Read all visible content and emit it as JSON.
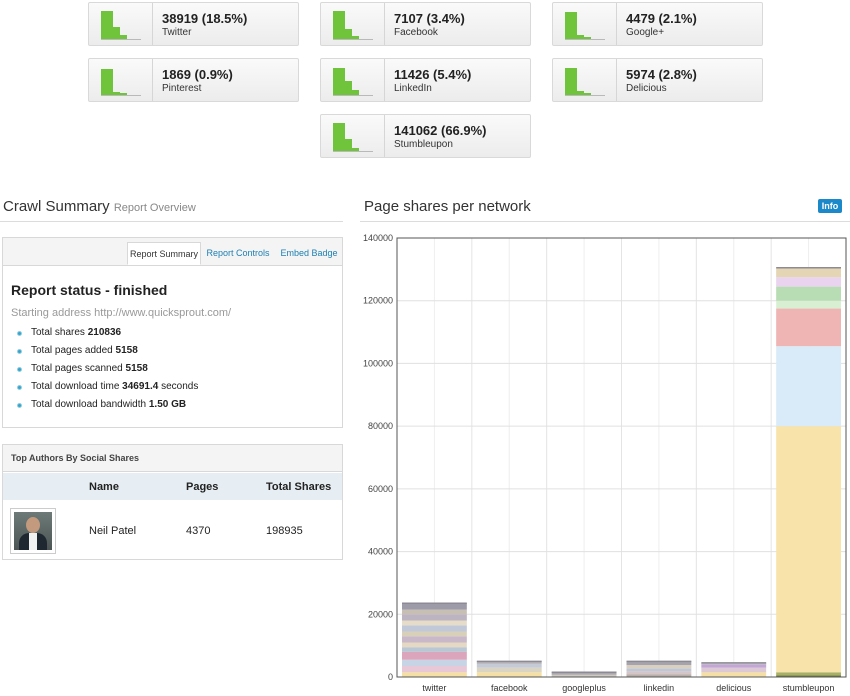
{
  "networks": [
    {
      "value": "38919 (18.5%)",
      "name": "Twitter"
    },
    {
      "value": "7107 (3.4%)",
      "name": "Facebook"
    },
    {
      "value": "4479 (2.1%)",
      "name": "Google+"
    },
    {
      "value": "1869 (0.9%)",
      "name": "Pinterest"
    },
    {
      "value": "11426 (5.4%)",
      "name": "LinkedIn"
    },
    {
      "value": "5974 (2.8%)",
      "name": "Delicious"
    },
    {
      "value": "141062 (66.9%)",
      "name": "Stumbleupon"
    }
  ],
  "crawl": {
    "title": "Crawl Summary",
    "subtitle": "Report Overview",
    "tabs": [
      "Report Summary",
      "Report Controls",
      "Embed Badge"
    ],
    "status": "Report status - finished",
    "start_address": "Starting address http://www.quicksprout.com/",
    "stats": [
      {
        "label": "Total shares",
        "value": "210836",
        "suffix": ""
      },
      {
        "label": "Total pages added",
        "value": "5158",
        "suffix": ""
      },
      {
        "label": "Total pages scanned",
        "value": "5158",
        "suffix": ""
      },
      {
        "label": "Total download time",
        "value": "34691.4",
        "suffix": "seconds"
      },
      {
        "label": "Total download bandwidth",
        "value": "1.50 GB",
        "suffix": ""
      }
    ]
  },
  "authors": {
    "title": "Top Authors By Social Shares",
    "columns": {
      "name": "Name",
      "pages": "Pages",
      "shares": "Total Shares"
    },
    "rows": [
      {
        "name": "Neil Patel",
        "pages": "4370",
        "shares": "198935",
        "avatar": "author-photo"
      }
    ]
  },
  "chart_title": "Page shares per network",
  "info_label": "Info",
  "colors": {
    "spark": "#6fc43b",
    "link": "#1c7fb3",
    "info": "#1b88c9"
  },
  "chart_data": {
    "type": "bar",
    "stacked": true,
    "categories": [
      "twitter",
      "facebook",
      "googleplus",
      "linkedin",
      "delicious",
      "stumbleupon"
    ],
    "values": [
      23500,
      5000,
      1500,
      5000,
      4500,
      130500
    ],
    "ylim": [
      0,
      140000
    ],
    "yticks": [
      0,
      20000,
      40000,
      60000,
      80000,
      100000,
      120000,
      140000
    ],
    "grid": true,
    "segments": [
      [
        {
          "from": 0,
          "to": 1500,
          "color": "#f5dfa3"
        },
        {
          "from": 1500,
          "to": 3500,
          "color": "#e8c7d6"
        },
        {
          "from": 3500,
          "to": 5500,
          "color": "#c7d4e6"
        },
        {
          "from": 5500,
          "to": 8000,
          "color": "#dba6bc"
        },
        {
          "from": 8000,
          "to": 9500,
          "color": "#b9c6d3"
        },
        {
          "from": 9500,
          "to": 11000,
          "color": "#e6d9c4"
        },
        {
          "from": 11000,
          "to": 13000,
          "color": "#c9b8c8"
        },
        {
          "from": 13000,
          "to": 14500,
          "color": "#d8d0b8"
        },
        {
          "from": 14500,
          "to": 16500,
          "color": "#c1c9d8"
        },
        {
          "from": 16500,
          "to": 18000,
          "color": "#e6dcc8"
        },
        {
          "from": 18000,
          "to": 20000,
          "color": "#bdb4c2"
        },
        {
          "from": 20000,
          "to": 21500,
          "color": "#c7bfb3"
        },
        {
          "from": 21500,
          "to": 23500,
          "color": "#9e9ba8"
        }
      ],
      [
        {
          "from": 0,
          "to": 1500,
          "color": "#f5dfa3"
        },
        {
          "from": 1500,
          "to": 3000,
          "color": "#d9d4c4"
        },
        {
          "from": 3000,
          "to": 4200,
          "color": "#c4cbd6"
        },
        {
          "from": 4200,
          "to": 5000,
          "color": "#b5b0b8"
        }
      ],
      [
        {
          "from": 0,
          "to": 700,
          "color": "#cfcac0"
        },
        {
          "from": 700,
          "to": 1500,
          "color": "#a9a7ae"
        }
      ],
      [
        {
          "from": 0,
          "to": 800,
          "color": "#b8b0a8"
        },
        {
          "from": 800,
          "to": 1800,
          "color": "#d4c6c8"
        },
        {
          "from": 1800,
          "to": 2800,
          "color": "#c0c7d2"
        },
        {
          "from": 2800,
          "to": 3800,
          "color": "#d9d0c0"
        },
        {
          "from": 3800,
          "to": 5000,
          "color": "#a6a3ad"
        }
      ],
      [
        {
          "from": 0,
          "to": 1500,
          "color": "#f5dfa3"
        },
        {
          "from": 1500,
          "to": 3000,
          "color": "#ddc9d6"
        },
        {
          "from": 3000,
          "to": 4000,
          "color": "#c2a6d6"
        },
        {
          "from": 4000,
          "to": 4500,
          "color": "#c3c3c7"
        }
      ],
      [
        {
          "from": 0,
          "to": 500,
          "color": "#6e7d3a"
        },
        {
          "from": 500,
          "to": 1500,
          "color": "#a8b065"
        },
        {
          "from": 1500,
          "to": 80000,
          "color": "#f8e3aa"
        },
        {
          "from": 80000,
          "to": 105500,
          "color": "#d9ebf8"
        },
        {
          "from": 105500,
          "to": 117500,
          "color": "#efb4b4"
        },
        {
          "from": 117500,
          "to": 120000,
          "color": "#d9efd2"
        },
        {
          "from": 120000,
          "to": 124500,
          "color": "#b8dcb4"
        },
        {
          "from": 124500,
          "to": 127500,
          "color": "#e9d3ef"
        },
        {
          "from": 127500,
          "to": 130500,
          "color": "#e4d6b4"
        }
      ]
    ]
  }
}
